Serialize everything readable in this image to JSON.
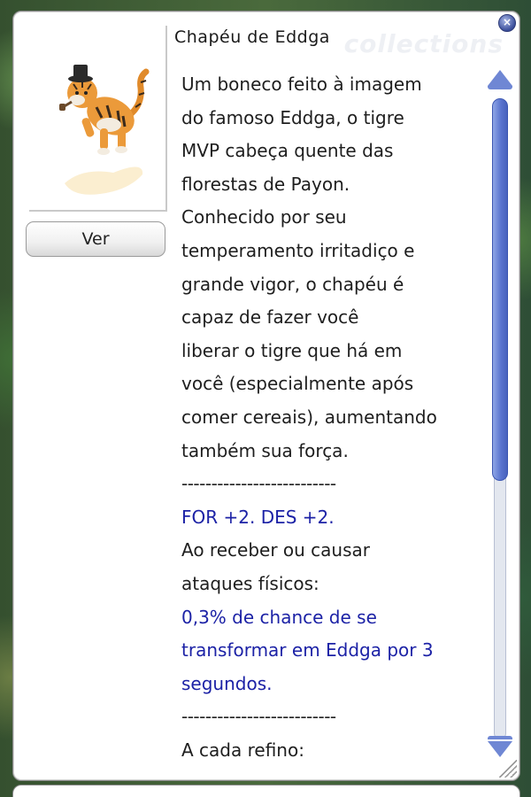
{
  "window": {
    "title": "Chapéu de Eddga",
    "watermark": "collections",
    "close_symbol": "×",
    "view_button_label": "Ver"
  },
  "item_image": {
    "icon": "tiger-hat-icon",
    "alt": "Chapéu de Eddga"
  },
  "description": {
    "lines": [
      {
        "text": "Um boneco feito à imagem",
        "style": "normal"
      },
      {
        "text": "do famoso Eddga, o tigre",
        "style": "normal"
      },
      {
        "text": "MVP cabeça quente das",
        "style": "normal"
      },
      {
        "text": "florestas de Payon.",
        "style": "normal"
      },
      {
        "text": "Conhecido por seu",
        "style": "normal"
      },
      {
        "text": "temperamento irritadiço e",
        "style": "normal"
      },
      {
        "text": "grande vigor, o chapéu é",
        "style": "normal"
      },
      {
        "text": "capaz de fazer você",
        "style": "normal"
      },
      {
        "text": "liberar o tigre que há em",
        "style": "normal"
      },
      {
        "text": "você (especialmente após",
        "style": "normal"
      },
      {
        "text": "comer cereais), aumentando",
        "style": "normal"
      },
      {
        "text": "também sua força.",
        "style": "normal"
      },
      {
        "text": "--------------------------",
        "style": "separator"
      },
      {
        "text": "FOR +2. DES +2.",
        "style": "highlight"
      },
      {
        "text": "Ao receber ou causar",
        "style": "normal"
      },
      {
        "text": "ataques físicos:",
        "style": "normal"
      },
      {
        "text": "0,3% de chance de se",
        "style": "highlight"
      },
      {
        "text": "transformar em Eddga por 3",
        "style": "highlight"
      },
      {
        "text": "segundos.",
        "style": "highlight"
      },
      {
        "text": "--------------------------",
        "style": "separator"
      },
      {
        "text": "A cada refino:",
        "style": "normal"
      }
    ]
  },
  "scrollbar": {
    "position_fraction": 0.0,
    "visible_fraction": 0.6
  },
  "colors": {
    "highlight_text": "#1c22a6",
    "scrollbar_accent": "#5a75cf"
  }
}
